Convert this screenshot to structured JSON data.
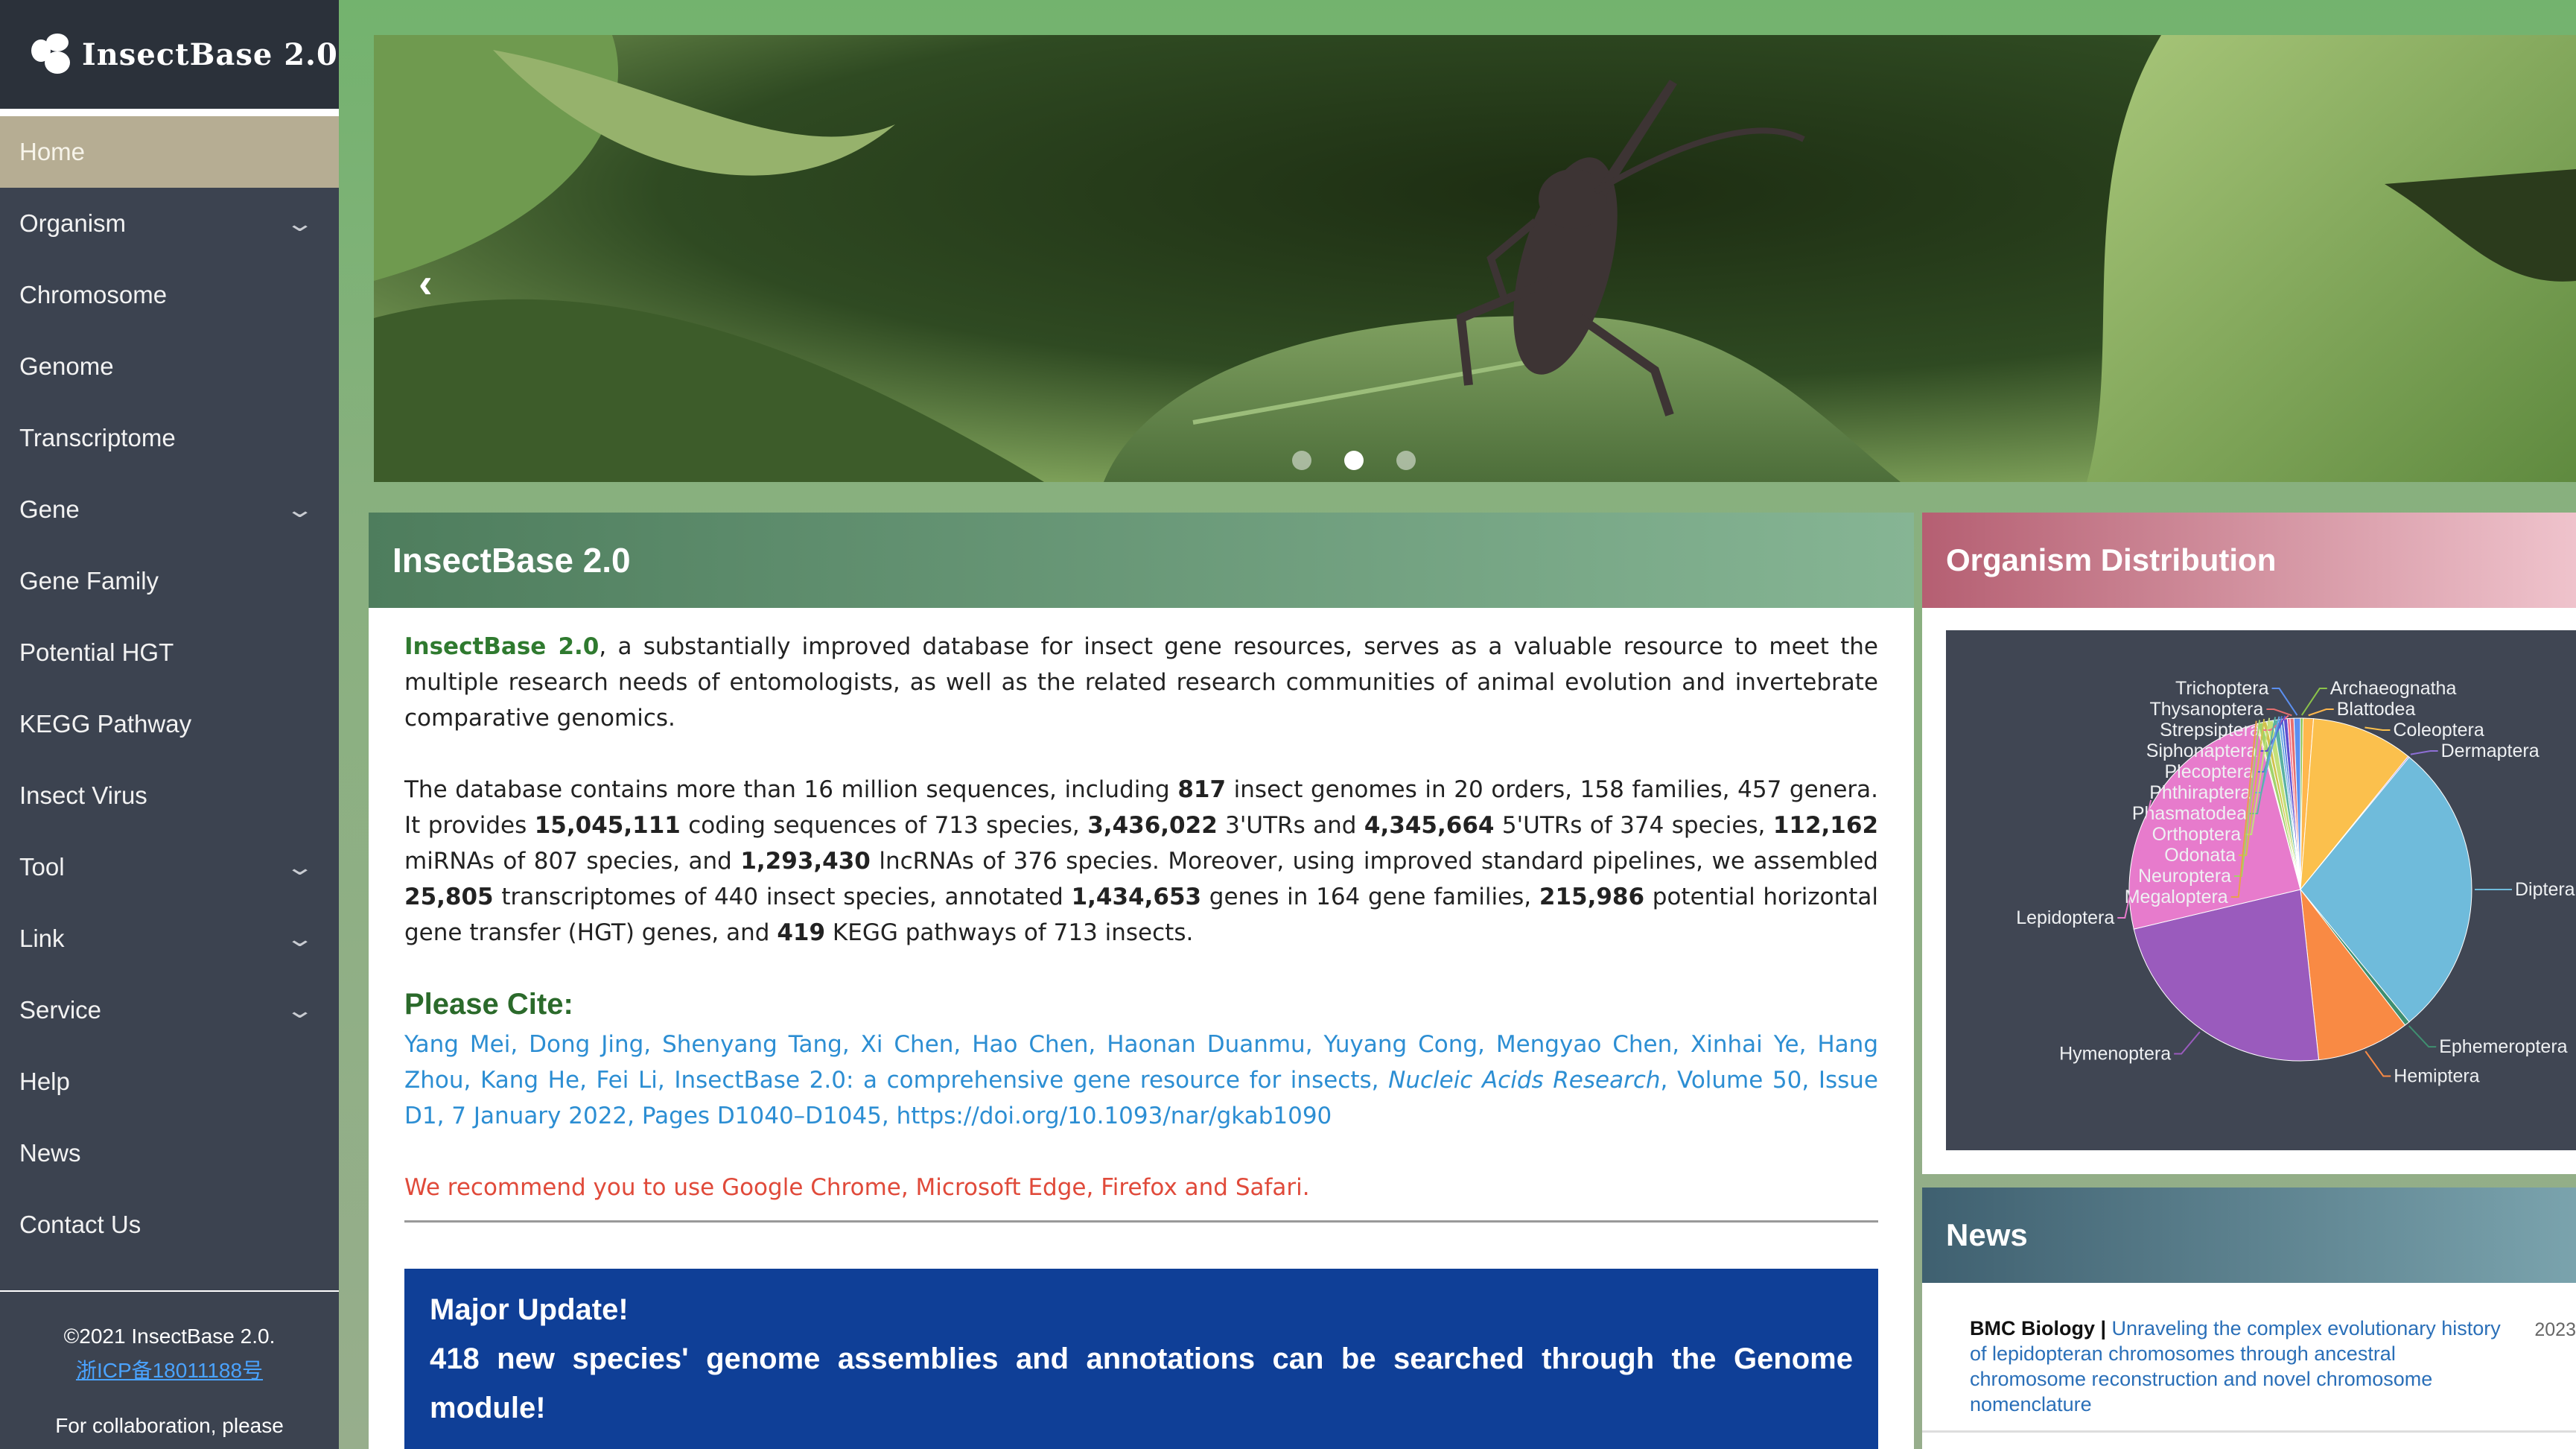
{
  "brand": {
    "title": "InsectBase 2.0"
  },
  "sidebar": {
    "items": [
      {
        "label": "Home",
        "active": true,
        "has_submenu": false
      },
      {
        "label": "Organism",
        "has_submenu": true
      },
      {
        "label": "Chromosome",
        "has_submenu": false
      },
      {
        "label": "Genome",
        "has_submenu": false
      },
      {
        "label": "Transcriptome",
        "has_submenu": false
      },
      {
        "label": "Gene",
        "has_submenu": true
      },
      {
        "label": "Gene Family",
        "has_submenu": false
      },
      {
        "label": "Potential HGT",
        "has_submenu": false
      },
      {
        "label": "KEGG Pathway",
        "has_submenu": false
      },
      {
        "label": "Insect Virus",
        "has_submenu": false
      },
      {
        "label": "Tool",
        "has_submenu": true
      },
      {
        "label": "Link",
        "has_submenu": true
      },
      {
        "label": "Service",
        "has_submenu": true
      },
      {
        "label": "Help",
        "has_submenu": false
      },
      {
        "label": "News",
        "has_submenu": false
      },
      {
        "label": "Contact Us",
        "has_submenu": false
      }
    ],
    "footer": {
      "copyright": "©2021 InsectBase 2.0.",
      "icp": "浙ICP备18011188号",
      "collab": "For collaboration, please"
    }
  },
  "carousel": {
    "prev_icon": "chevron-left-icon",
    "slides": 3,
    "active_slide": 2
  },
  "about": {
    "title": "InsectBase 2.0",
    "intro_name": "InsectBase 2.0",
    "intro_rest": ", a substantially improved database for insect gene resources, serves as a valuable resource to meet the multiple research needs of entomologists, as well as the related research communities of animal evolution and invertebrate comparative genomics.",
    "stats": {
      "t1": "The database contains more than 16 million sequences, including ",
      "genomes": "817",
      "t2": " insect genomes in 20 orders, 158 families, 457 genera. It provides ",
      "cds": "15,045,111",
      "t3": " coding sequences of 713 species, ",
      "utr3": "3,436,022",
      "t4": " 3'UTRs and ",
      "utr5": "4,345,664",
      "t5": " 5'UTRs of 374 species, ",
      "mirna": "112,162",
      "t6": " miRNAs of 807 species, and ",
      "lncrna": "1,293,430",
      "t7": " lncRNAs of 376 species. Moreover, using improved standard pipelines, we assembled ",
      "transcriptomes": "25,805",
      "t8": " transcriptomes of 440 insect species, annotated ",
      "genes": "1,434,653",
      "t9": " genes in 164 gene families, ",
      "hgt": "215,986",
      "t10": " potential horizontal gene transfer (HGT) genes, and ",
      "kegg": "419",
      "t11": " KEGG pathways of 713 insects."
    },
    "cite_heading": "Please Cite:",
    "cite_authors": "Yang Mei, Dong Jing, Shenyang Tang, Xi Chen, Hao Chen, Haonan Duanmu, Yuyang Cong, Mengyao Chen, Xinhai Ye, Hang Zhou, Kang He, Fei Li, InsectBase 2.0: a comprehensive gene resource for insects, ",
    "cite_journal": "Nucleic Acids Research",
    "cite_rest": ", Volume 50, Issue D1, 7 January 2022, Pages D1040–D1045, https://doi.org/10.1093/nar/gkab1090",
    "recommend": "We recommend you to use Google Chrome, Microsoft Edge, Firefox and Safari.",
    "update_title": "Major Update!",
    "update_text": "418 new species' genome assemblies and annotations can be searched through the Genome module!"
  },
  "distribution": {
    "title": "Organism Distribution",
    "chart_data": {
      "type": "pie",
      "title": "",
      "slices": [
        {
          "name": "Archaeognatha",
          "value": 2,
          "color": "#8bc34a"
        },
        {
          "name": "Blattodea",
          "value": 8,
          "color": "#ffb74d"
        },
        {
          "name": "Coleoptera",
          "value": 79,
          "color": "#fbc04d"
        },
        {
          "name": "Dermaptera",
          "value": 1,
          "color": "#8e6fd6"
        },
        {
          "name": "Diptera",
          "value": 231,
          "color": "#6fbbdb"
        },
        {
          "name": "Ephemeroptera",
          "value": 4,
          "color": "#3f8f70"
        },
        {
          "name": "Hemiptera",
          "value": 72,
          "color": "#f98a44"
        },
        {
          "name": "Hymenoptera",
          "value": 189,
          "color": "#9a5bbd"
        },
        {
          "name": "Lepidoptera",
          "value": 202,
          "color": "#e77bcc"
        },
        {
          "name": "Megaloptera",
          "value": 1,
          "color": "#e8a04c"
        },
        {
          "name": "Neuroptera",
          "value": 4,
          "color": "#a2d36a"
        },
        {
          "name": "Odonata",
          "value": 3,
          "color": "#d1c24d"
        },
        {
          "name": "Orthoptera",
          "value": 5,
          "color": "#c3e07a"
        },
        {
          "name": "Phasmatodea",
          "value": 4,
          "color": "#5ab2a3"
        },
        {
          "name": "Phthiraptera",
          "value": 2,
          "color": "#67a7e4"
        },
        {
          "name": "Plecoptera",
          "value": 2,
          "color": "#4b79d9"
        },
        {
          "name": "Siphonaptera",
          "value": 3,
          "color": "#5f4fcf"
        },
        {
          "name": "Strepsiptera",
          "value": 2,
          "color": "#f36c8a"
        },
        {
          "name": "Thysanoptera",
          "value": 3,
          "color": "#e66f6f"
        },
        {
          "name": "Trichoptera",
          "value": 5,
          "color": "#5b8ff0"
        }
      ]
    }
  },
  "news": {
    "title": "News",
    "items": [
      {
        "source": "BMC Biology | ",
        "text": "Unraveling the complex evolutionary history of lepidopteran chromosomes through ancestral chromosome reconstruction and novel chromosome nomenclature",
        "date": "2023"
      }
    ]
  }
}
